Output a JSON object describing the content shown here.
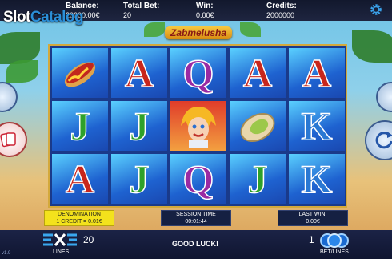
{
  "header": {
    "balance_label": "Balance:",
    "balance_value": "20000.00€",
    "total_bet_label": "Total Bet:",
    "total_bet_value": "20",
    "win_label": "Win:",
    "win_value": "0.00€",
    "credits_label": "Credits:",
    "credits_value": "2000000",
    "settings_icon": "gear-icon"
  },
  "watermark": {
    "part1": "Slot",
    "part2": "Catalog"
  },
  "game_title": "Zabmelusha",
  "reels": [
    [
      "hotdog",
      "J",
      "A"
    ],
    [
      "A",
      "J",
      "J"
    ],
    [
      "Q",
      "girl",
      "Q"
    ],
    [
      "A",
      "pistachio",
      "J"
    ],
    [
      "A",
      "K",
      "K"
    ]
  ],
  "info": {
    "denomination_label": "DENOMINATION",
    "denomination_value": "1 CREDIT = 0.01€",
    "session_label": "SESSION TIME",
    "session_value": "00:01:44",
    "last_win_label": "LAST WIN:",
    "last_win_value": "0.00€"
  },
  "footer": {
    "lines_value": "20",
    "lines_label": "LINES",
    "message": "GOOD LUCK!",
    "bet_value": "1",
    "bet_label": "BET/LINES",
    "version": "v1.9"
  },
  "colors": {
    "A": "#c8261c",
    "J": "#2ea12a",
    "Q": "#9a2aa3",
    "K": "#2a78d3",
    "frame": "#d4a93b"
  }
}
